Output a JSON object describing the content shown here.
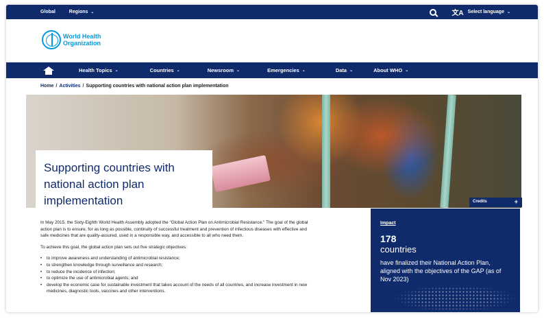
{
  "topbar": {
    "global": "Global",
    "regions": "Regions",
    "chevron": "⌄",
    "select_language": "Select language",
    "lang_glyph": "文A"
  },
  "logo": {
    "line1": "World Health",
    "line2": "Organization"
  },
  "nav": {
    "items": [
      {
        "label": "Health Topics"
      },
      {
        "label": "Countries"
      },
      {
        "label": "Newsroom"
      },
      {
        "label": "Emergencies"
      },
      {
        "label": "Data"
      },
      {
        "label": "About WHO"
      }
    ],
    "chevron": "⌄"
  },
  "breadcrumb": {
    "home": "Home",
    "activities": "Activities",
    "separator": "/",
    "current": "Supporting countries with national action plan implementation"
  },
  "hero": {
    "title_line1": "Supporting countries with",
    "title_line2": "national action plan",
    "title_line3": "implementation",
    "credits": "Credits",
    "credits_plus": "+"
  },
  "content": {
    "para1": "In May 2015, the Sixty-Eighth World Health Assembly adopted the \"Global Action Plan on Antimicrobial Resistance.\" The goal of the global action plan is to ensure, for as long as possible, continuity of successful treatment and prevention of infectious diseases with effective and safe medicines that are quality-assured, used in a responsible way, and accessible to all who need them.",
    "para2": "To achieve this goal, the global action plan sets out five strategic objectives:",
    "objectives": [
      "to improve awareness and understanding of antimicrobial resistance;",
      "to strengthen knowledge through surveillance and research;",
      "to reduce the incidence of infection;",
      "to optimize the use of antimicrobial agents; and",
      "develop the economic case for sustainable investment that takes account of the needs of all countries, and increase investment in new medicines, diagnostic tools, vaccines and other interventions."
    ]
  },
  "impact": {
    "tag": "Impact",
    "number": "178",
    "unit": "countries",
    "description": "have finalized their National Action Plan, aligned with the objectives of the GAP (as of Nov 2023)"
  },
  "colors": {
    "brand_navy": "#0f2b6b",
    "logo_blue": "#009ade"
  }
}
